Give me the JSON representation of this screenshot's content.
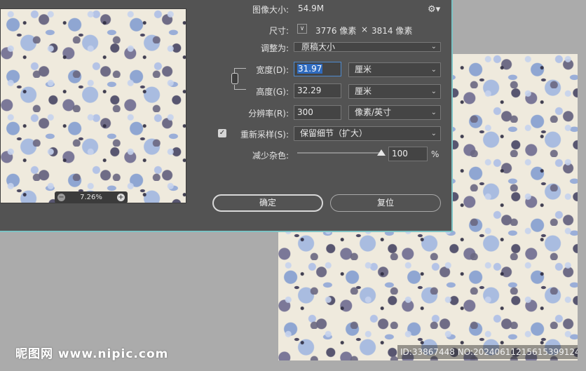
{
  "dialog": {
    "image_size_label": "图像大小:",
    "image_size_value": "54.9M",
    "dimensions_label": "尺寸:",
    "dimensions_width": "3776 像素",
    "dimensions_sep": "×",
    "dimensions_height": "3814 像素",
    "fit_to_label": "调整为:",
    "fit_to_value": "原稿大小",
    "width_label": "宽度(D):",
    "width_value": "31.97",
    "width_unit": "厘米",
    "height_label": "高度(G):",
    "height_value": "32.29",
    "height_unit": "厘米",
    "resolution_label": "分辨率(R):",
    "resolution_value": "300",
    "resolution_unit": "像素/英寸",
    "resample_label": "重新采样(S):",
    "resample_checked": true,
    "resample_value": "保留细节（扩大）",
    "noise_label": "减少杂色:",
    "noise_value": "100",
    "noise_unit": "%",
    "noise_level_percent": 100,
    "ok_button": "确定",
    "reset_button": "复位",
    "zoom_level": "7.26%"
  },
  "icons": [
    "gear-icon",
    "dropdown-arrow-icon",
    "link-chain-icon",
    "checkbox-check-icon",
    "zoom-out-icon",
    "zoom-in-icon"
  ],
  "watermark": {
    "logo_text": "昵图网 www.nipic.com",
    "id_text": "ID:33867448 NO:20240611215615399124"
  },
  "colors": {
    "dialog_bg": "#535353",
    "accent_border": "#7dc3c4",
    "selection": "#2f6bbf"
  }
}
